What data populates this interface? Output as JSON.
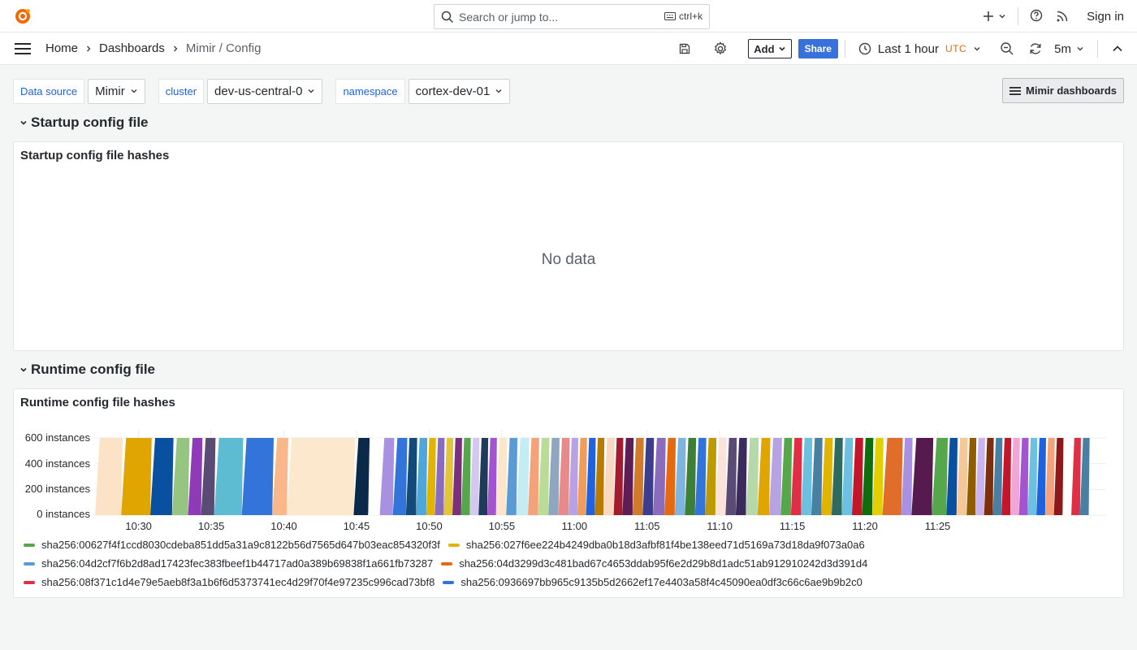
{
  "topbar": {
    "search_placeholder": "Search or jump to...",
    "search_shortcut": "ctrl+k",
    "sign_in": "Sign in"
  },
  "navbar": {
    "breadcrumbs": [
      "Home",
      "Dashboards",
      "Mimir / Config"
    ],
    "add_label": "Add",
    "share_label": "Share",
    "time_range": "Last 1 hour",
    "timezone": "UTC",
    "refresh_interval": "5m"
  },
  "variables": [
    {
      "label": "Data source",
      "value": "Mimir"
    },
    {
      "label": "cluster",
      "value": "dev-us-central-0"
    },
    {
      "label": "namespace",
      "value": "cortex-dev-01"
    }
  ],
  "dashboards_link": "Mimir dashboards",
  "rows": [
    {
      "title": "Startup config file"
    },
    {
      "title": "Runtime config file"
    }
  ],
  "panels": {
    "startup": {
      "title": "Startup config file hashes",
      "message": "No data"
    },
    "runtime": {
      "title": "Runtime config file hashes"
    }
  },
  "chart_data": {
    "type": "area",
    "title": "Runtime config file hashes",
    "stacked": true,
    "y_ticks": [
      "0 instances",
      "200 instances",
      "400 instances",
      "600 instances"
    ],
    "ylim": [
      0,
      600
    ],
    "x_ticks": [
      "10:30",
      "10:35",
      "10:40",
      "10:45",
      "10:50",
      "10:55",
      "11:00",
      "11:05",
      "11:10",
      "11:15",
      "11:20",
      "11:25"
    ],
    "xlim": [
      "10:27",
      "11:28"
    ],
    "total_instances": 600,
    "series": [
      {
        "name": "sha256:00627f4f1ccd8030cdeba851dd5a31a9c8122b56d7565d647b03eac854320f3f",
        "color": "#56a64b"
      },
      {
        "name": "sha256:027f6ee224b4249dba0b18d3afbf81f4be138eed71d5169a73d18da9f073a0a6",
        "color": "#e0b400"
      },
      {
        "name": "sha256:04d2cf7f6b2d8ad17423fec383fbeef1b44717ad0a389b69838f1a661fb73287",
        "color": "#5b9bd5"
      },
      {
        "name": "sha256:04d3299d3c481bad67c4653ddab95f6e2d29b8d1adc51ab912910242d3d391d4",
        "color": "#e5690f"
      },
      {
        "name": "sha256:08f371c1d4e79e5aeb8f3a1b6f6d5373741ec4d29f70f4e97235c996cad73bf8",
        "color": "#e02f44"
      },
      {
        "name": "sha256:0936697bb965c9135b5d2662ef17e4403a58f4c45090ea0df3c66c6ae9b9b2c0",
        "color": "#3274d9"
      }
    ],
    "bands": [
      {
        "start": "10:27.0",
        "end": "10:28.8",
        "color": "#fce2c7"
      },
      {
        "start": "10:28.8",
        "end": "10:30.8",
        "color": "#e0a500"
      },
      {
        "start": "10:30.8",
        "end": "10:32.3",
        "color": "#0a50a1"
      },
      {
        "start": "10:32.3",
        "end": "10:33.4",
        "color": "#96c582"
      },
      {
        "start": "10:33.4",
        "end": "10:34.3",
        "color": "#8f3bb8"
      },
      {
        "start": "10:34.3",
        "end": "10:35.2",
        "color": "#5a4b74"
      },
      {
        "start": "10:35.2",
        "end": "10:37.1",
        "color": "#5dbcd2"
      },
      {
        "start": "10:37.1",
        "end": "10:39.2",
        "color": "#3274d9"
      },
      {
        "start": "10:39.2",
        "end": "10:40.2",
        "color": "#f9b78a"
      },
      {
        "start": "10:40.2",
        "end": "10:44.8",
        "color": "#fce8cc"
      },
      {
        "start": "10:44.8",
        "end": "10:45.8",
        "color": "#0b2a4a"
      },
      {
        "start": "10:45.8",
        "end": "10:46.6",
        "color": "#ffffff"
      },
      {
        "start": "10:46.6",
        "end": "10:47.5",
        "color": "#a891e0"
      },
      {
        "start": "10:47.5",
        "end": "10:48.4",
        "color": "#3274d9"
      },
      {
        "start": "10:48.4",
        "end": "10:49.1",
        "color": "#124b7a"
      },
      {
        "start": "10:49.1",
        "end": "10:49.8",
        "color": "#4fa6d9"
      },
      {
        "start": "10:49.8",
        "end": "10:50.4",
        "color": "#e0b400"
      },
      {
        "start": "10:50.4",
        "end": "10:51.0",
        "color": "#8a6bbd"
      },
      {
        "start": "10:51.0",
        "end": "10:51.6",
        "color": "#e1c53b"
      },
      {
        "start": "10:51.6",
        "end": "10:52.2",
        "color": "#7c2f7c"
      },
      {
        "start": "10:52.2",
        "end": "10:52.8",
        "color": "#56a64b"
      },
      {
        "start": "10:52.8",
        "end": "10:53.4",
        "color": "#d4c8f0"
      },
      {
        "start": "10:53.4",
        "end": "10:54.0",
        "color": "#1f3b5a"
      },
      {
        "start": "10:54.0",
        "end": "10:54.6",
        "color": "#a454d0"
      },
      {
        "start": "10:54.6",
        "end": "10:55.3",
        "color": "#fbe6c9"
      },
      {
        "start": "10:55.3",
        "end": "10:56.0",
        "color": "#5b9bd5"
      },
      {
        "start": "10:56.0",
        "end": "10:56.8",
        "color": "#c3ecf5"
      },
      {
        "start": "10:56.8",
        "end": "10:57.5",
        "color": "#f5a27a"
      },
      {
        "start": "10:57.5",
        "end": "10:58.2",
        "color": "#b9dc97"
      },
      {
        "start": "10:58.2",
        "end": "10:58.9",
        "color": "#8ea6c0"
      },
      {
        "start": "10:58.9",
        "end": "10:59.6",
        "color": "#e88a8a"
      },
      {
        "start": "10:59.6",
        "end": "11:00.2",
        "color": "#b7a3e3"
      },
      {
        "start": "11:00.2",
        "end": "11:00.8",
        "color": "#f29c5a"
      },
      {
        "start": "11:00.8",
        "end": "11:01.4",
        "color": "#1f62e0"
      },
      {
        "start": "11:01.4",
        "end": "11:02.0",
        "color": "#b87a00"
      },
      {
        "start": "11:02.0",
        "end": "11:02.7",
        "color": "#f8d8c0"
      },
      {
        "start": "11:02.7",
        "end": "11:03.3",
        "color": "#a31b2e"
      },
      {
        "start": "11:03.3",
        "end": "11:04.0",
        "color": "#5e1d54"
      },
      {
        "start": "11:04.0",
        "end": "11:04.7",
        "color": "#d07a2a"
      },
      {
        "start": "11:04.7",
        "end": "11:05.4",
        "color": "#3d3d8f"
      },
      {
        "start": "11:05.4",
        "end": "11:06.2",
        "color": "#8a6bbd"
      },
      {
        "start": "11:06.2",
        "end": "11:06.9",
        "color": "#e5690f"
      },
      {
        "start": "11:06.9",
        "end": "11:07.6",
        "color": "#7eb5e0"
      },
      {
        "start": "11:07.6",
        "end": "11:08.3",
        "color": "#3e7f38"
      },
      {
        "start": "11:08.3",
        "end": "11:09.0",
        "color": "#3274d9"
      },
      {
        "start": "11:09.0",
        "end": "11:09.7",
        "color": "#bd9a00"
      },
      {
        "start": "11:09.7",
        "end": "11:10.4",
        "color": "#fce2da"
      },
      {
        "start": "11:10.4",
        "end": "11:11.1",
        "color": "#5a4b74"
      },
      {
        "start": "11:11.1",
        "end": "11:11.8",
        "color": "#3b2b5c"
      },
      {
        "start": "11:11.8",
        "end": "11:12.6",
        "color": "#b7d8a9"
      },
      {
        "start": "11:12.6",
        "end": "11:13.4",
        "color": "#e0a500"
      },
      {
        "start": "11:13.4",
        "end": "11:14.2",
        "color": "#b7a3e3"
      },
      {
        "start": "11:14.2",
        "end": "11:14.9",
        "color": "#56a64b"
      },
      {
        "start": "11:14.9",
        "end": "11:15.6",
        "color": "#e02f44"
      },
      {
        "start": "11:15.6",
        "end": "11:16.3",
        "color": "#6cc0e0"
      },
      {
        "start": "11:16.3",
        "end": "11:17.0",
        "color": "#497fa3"
      },
      {
        "start": "11:17.0",
        "end": "11:17.7",
        "color": "#e0b400"
      },
      {
        "start": "11:17.7",
        "end": "11:18.4",
        "color": "#2e6a5e"
      },
      {
        "start": "11:18.4",
        "end": "11:19.1",
        "color": "#6cc0e0"
      },
      {
        "start": "11:19.1",
        "end": "11:19.8",
        "color": "#c4162a"
      },
      {
        "start": "11:19.8",
        "end": "11:20.5",
        "color": "#0e6e0e"
      },
      {
        "start": "11:20.5",
        "end": "11:21.2",
        "color": "#e3cf00"
      },
      {
        "start": "11:21.2",
        "end": "11:22.5",
        "color": "#e06e2a"
      },
      {
        "start": "11:22.5",
        "end": "11:23.2",
        "color": "#a891e0"
      },
      {
        "start": "11:23.2",
        "end": "11:24.6",
        "color": "#561a4f"
      },
      {
        "start": "11:24.6",
        "end": "11:25.6",
        "color": "#56a64b"
      },
      {
        "start": "11:25.6",
        "end": "11:26.3",
        "color": "#0a50a1"
      },
      {
        "start": "11:26.3",
        "end": "11:27.0",
        "color": "#f5c89a"
      },
      {
        "start": "11:27.0",
        "end": "11:27.6",
        "color": "#8f5c00"
      },
      {
        "start": "11:27.6",
        "end": "11:28.2",
        "color": "#c9b3f0"
      },
      {
        "start": "11:28.2",
        "end": "11:28.8",
        "color": "#7c2f0c"
      },
      {
        "start": "11:28.8",
        "end": "11:29.4",
        "color": "#497fa3"
      },
      {
        "start": "11:29.4",
        "end": "11:30.0",
        "color": "#c4162a"
      },
      {
        "start": "11:30.0",
        "end": "11:30.6",
        "color": "#f2a6d8"
      },
      {
        "start": "11:30.6",
        "end": "11:31.2",
        "color": "#a454d0"
      },
      {
        "start": "11:31.2",
        "end": "11:31.8",
        "color": "#6cc0e0"
      },
      {
        "start": "11:31.8",
        "end": "11:32.4",
        "color": "#1f62e0"
      },
      {
        "start": "11:32.4",
        "end": "11:33.0",
        "color": "#f5a27a"
      },
      {
        "start": "11:33.0",
        "end": "11:33.6",
        "color": "#8c1a1a"
      },
      {
        "start": "11:33.6",
        "end": "11:34.2",
        "color": "#ffffff"
      },
      {
        "start": "11:34.2",
        "end": "11:34.8",
        "color": "#e02f44"
      },
      {
        "start": "11:34.8",
        "end": "11:35.4",
        "color": "#497fa3"
      }
    ]
  }
}
